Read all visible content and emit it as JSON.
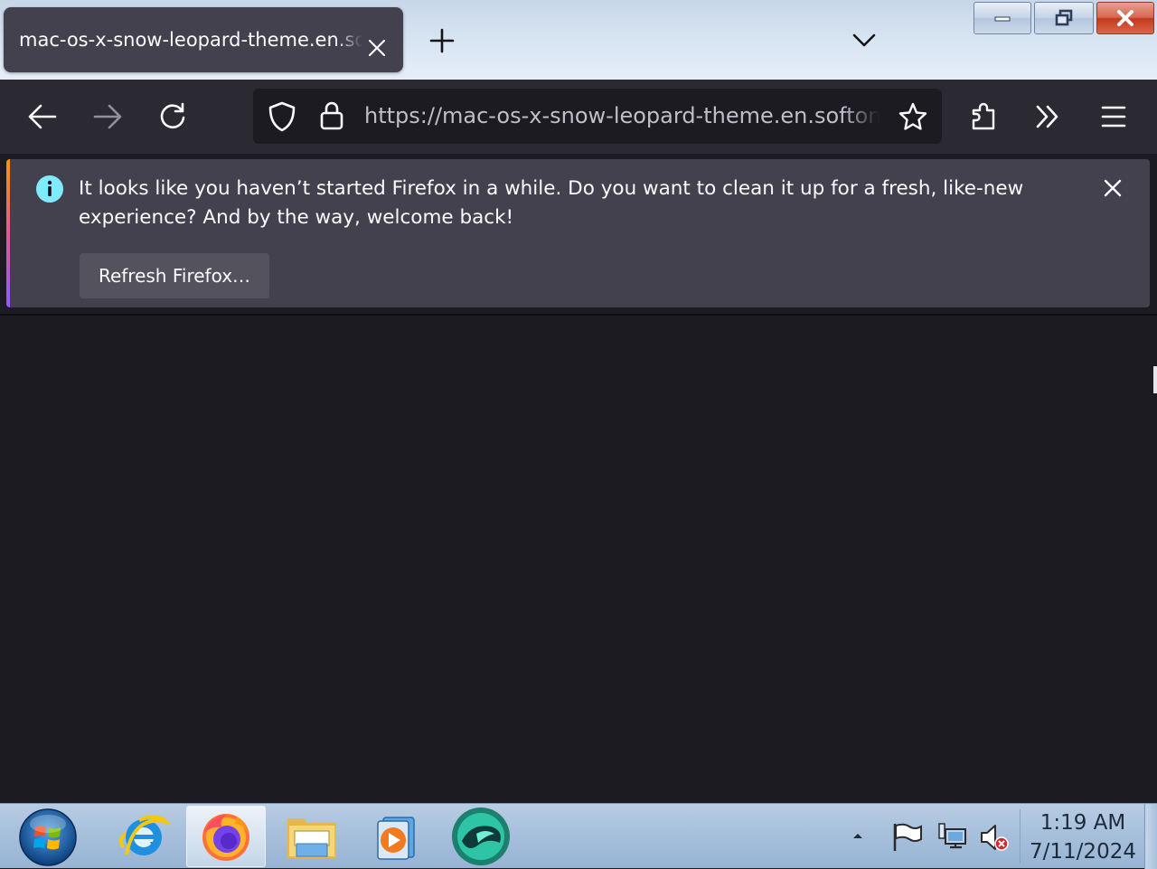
{
  "window": {
    "tab_title": "mac-os-x-snow-leopard-theme.en.softonic.com",
    "caption_buttons": [
      "minimize-icon",
      "restore-icon",
      "close-icon"
    ]
  },
  "navbar": {
    "url": "https://mac-os-x-snow-leopard-theme.en.softonic.com",
    "icons": [
      "back-arrow-icon",
      "forward-arrow-icon",
      "reload-icon",
      "shield-icon",
      "lock-icon",
      "bookmark-star-icon",
      "extensions-icon",
      "overflow-chevrons-icon",
      "hamburger-menu-icon"
    ]
  },
  "notification": {
    "message": "It looks like you haven’t started Firefox in a while. Do you want to clean it up for a fresh, like-new experience? And by the way, welcome back!",
    "button_label": "Refresh Firefox…",
    "icon": "info-icon"
  },
  "taskbar": {
    "pinned": [
      "internet-explorer-icon",
      "firefox-icon",
      "file-explorer-icon",
      "media-player-icon",
      "app-icon"
    ],
    "active": "firefox-icon",
    "tray_icons": [
      "show-hidden-icons-arrow",
      "action-center-flag-icon",
      "network-icon",
      "volume-muted-icon"
    ],
    "time": "1:19 AM",
    "date": "7/11/2024"
  },
  "colors": {
    "toolbar": "#2b2a33",
    "urlbar": "#1c1b22",
    "notification": "#42414d",
    "info_accent": "#80ebff",
    "content": "#1c1b22"
  }
}
